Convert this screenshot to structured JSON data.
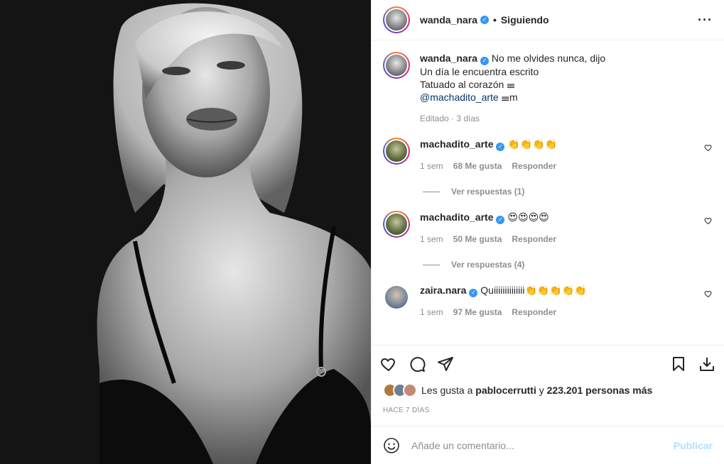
{
  "post": {
    "author": "wanda_nara",
    "follow_status": "Siguiendo",
    "more_icon": "ellipsis-icon"
  },
  "caption": {
    "author": "wanda_nara",
    "lines": [
      "No me olvides nunca, dijo",
      "Un día le encuentra escrito",
      "Tatuado al corazón 𝍢"
    ],
    "mention": "@machadito_arte",
    "mention_suffix": "𝍢m",
    "edited": "Editado · 3 días"
  },
  "comments": [
    {
      "author": "machadito_arte",
      "text": "👏👏👏👏",
      "time": "1 sem",
      "likes": "68 Me gusta",
      "reply": "Responder",
      "view_replies": "Ver respuestas (1)"
    },
    {
      "author": "machadito_arte",
      "text": "😍😍😍😍",
      "time": "1 sem",
      "likes": "50 Me gusta",
      "reply": "Responder",
      "view_replies": "Ver respuestas (4)"
    },
    {
      "author": "zaira.nara",
      "text": "Quiiiiiiiiiiiiii👏👏👏👏👏",
      "time": "1 sem",
      "likes": "97 Me gusta",
      "reply": "Responder"
    }
  ],
  "likes": {
    "prefix": "Les gusta a",
    "user": "pablocerrutti",
    "joiner": "y",
    "others": "223.201 personas más"
  },
  "date": "HACE 7 DÍAS",
  "add_comment": {
    "placeholder": "Añade un comentario...",
    "publish": "Publicar"
  },
  "colors": {
    "verified": "#3897f0",
    "mention": "#00376b",
    "muted": "#8e8e8e",
    "publish_disabled": "#b2dffc"
  }
}
